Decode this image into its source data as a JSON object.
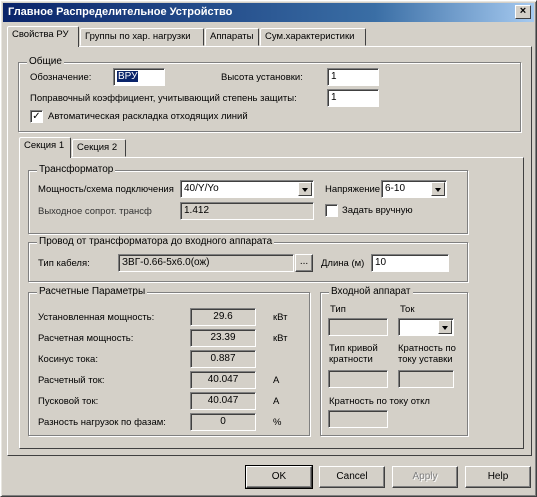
{
  "window": {
    "title": "Главное Распределительное Устройство",
    "close_glyph": "×"
  },
  "tabs": [
    {
      "label": "Свойства РУ"
    },
    {
      "label": "Группы по хар. нагрузки"
    },
    {
      "label": "Аппараты"
    },
    {
      "label": "Сум.характеристики"
    }
  ],
  "general": {
    "title": "Общие",
    "designation_label": "Обозначение:",
    "designation_value": "ВРУ",
    "height_label": "Высота установки:",
    "height_value": "1",
    "coef_label": "Поправочный коэффициент, учитывающий степень защиты:",
    "coef_value": "1",
    "auto_label": "Автоматическая раскладка отходящих линий",
    "auto_checked": true
  },
  "section_tabs": [
    {
      "label": "Секция 1"
    },
    {
      "label": "Секция 2"
    }
  ],
  "transformer": {
    "title": "Трансформатор",
    "scheme_label": "Мощность/схема подключения",
    "scheme_value": "40/Y/Yo",
    "voltage_label": "Напряжение",
    "voltage_value": "6-10",
    "resistance_label": "Выходное сопрот. трансф",
    "resistance_value": "1.412",
    "manual_label": "Задать вручную",
    "manual_checked": false
  },
  "wire": {
    "title": "Провод от трансформатора до входного аппарата",
    "cable_label": "Тип кабеля:",
    "cable_value": "ЗВГ-0.66-5х6.0(ож)",
    "browse_label": "...",
    "length_label": "Длина (м)",
    "length_value": "10"
  },
  "calc": {
    "title": "Расчетные Параметры",
    "rows": [
      {
        "label": "Установленная мощность:",
        "value": "29.6",
        "unit": "кВт"
      },
      {
        "label": "Расчетная мощность:",
        "value": "23.39",
        "unit": "кВт"
      },
      {
        "label": "Косинус тока:",
        "value": "0.887",
        "unit": ""
      },
      {
        "label": "Расчетный ток:",
        "value": "40.047",
        "unit": "А"
      },
      {
        "label": "Пусковой ток:",
        "value": "40.047",
        "unit": "А"
      },
      {
        "label": "Разность нагрузок по фазам:",
        "value": "0",
        "unit": "%"
      }
    ]
  },
  "input_device": {
    "title": "Входной аппарат",
    "type_label": "Тип",
    "current_label": "Ток",
    "type_value": "",
    "current_value": "",
    "curve_label_1": "Тип кривой",
    "curve_label_2": "кратности",
    "mult_label_1": "Кратность по",
    "mult_label_2": "току уставки",
    "curve_value": "",
    "mult_value": "",
    "mult_current_label": "Кратность по току откл",
    "mult_current_value": ""
  },
  "buttons": {
    "ok": "OK",
    "cancel": "Cancel",
    "apply": "Apply",
    "help": "Help"
  }
}
